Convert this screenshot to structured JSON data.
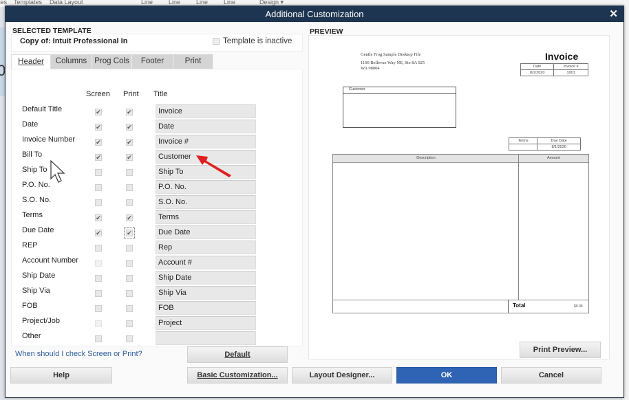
{
  "background": {
    "menu_items": [
      "tes",
      "Templates",
      "Data Layout",
      "Line",
      "Line",
      "Line",
      "Line",
      "Design ▾"
    ],
    "left_glyph": "0"
  },
  "dialog": {
    "title": "Additional Customization",
    "close_icon": "close-x-icon",
    "selected_template_label": "SELECTED TEMPLATE",
    "template_name": "Copy of: Intuit Professional In",
    "template_inactive_label": "Template is inactive",
    "template_inactive_checked": false,
    "tabs": [
      {
        "label": "Header",
        "active": true
      },
      {
        "label": "Columns",
        "active": false
      },
      {
        "label": "Prog Cols",
        "active": false
      },
      {
        "label": "Footer",
        "active": false
      },
      {
        "label": "Print",
        "active": false
      }
    ],
    "columns": {
      "screen": "Screen",
      "print": "Print",
      "title": "Title"
    },
    "rows": [
      {
        "label": "Default Title",
        "screen": true,
        "print": true,
        "title": "Invoice"
      },
      {
        "label": "Date",
        "screen": true,
        "print": true,
        "title": "Date"
      },
      {
        "label": "Invoice Number",
        "screen": true,
        "print": true,
        "title": "Invoice #"
      },
      {
        "label": "Bill To",
        "screen": true,
        "print": true,
        "title": "Customer"
      },
      {
        "label": "Ship To",
        "screen": false,
        "print": false,
        "title": "Ship To"
      },
      {
        "label": "P.O. No.",
        "screen": false,
        "print": false,
        "title": "P.O. No."
      },
      {
        "label": "S.O. No.",
        "screen": false,
        "print": false,
        "title": "S.O. No."
      },
      {
        "label": "Terms",
        "screen": true,
        "print": true,
        "title": "Terms"
      },
      {
        "label": "Due Date",
        "screen": true,
        "print": true,
        "title": "Due Date"
      },
      {
        "label": "REP",
        "screen": false,
        "print": false,
        "title": "Rep"
      },
      {
        "label": "Account Number",
        "screen": false,
        "print": false,
        "title": "Account #"
      },
      {
        "label": "Ship Date",
        "screen": false,
        "print": false,
        "title": "Ship Date"
      },
      {
        "label": "Ship Via",
        "screen": false,
        "print": false,
        "title": "Ship Via"
      },
      {
        "label": "FOB",
        "screen": false,
        "print": false,
        "title": "FOB"
      },
      {
        "label": "Project/Job",
        "screen": false,
        "print": false,
        "title": "Project"
      },
      {
        "label": "Other",
        "screen": false,
        "print": false,
        "title": ""
      }
    ],
    "help_link": "When should I check Screen or Print?",
    "default_button": "Default",
    "preview_label": "PREVIEW",
    "print_preview_button": "Print Preview...",
    "buttons": {
      "help": "Help",
      "basic_customization": "Basic Customization...",
      "layout_designer": "Layout Designer...",
      "ok": "OK",
      "cancel": "Cancel"
    }
  },
  "preview": {
    "company_name": "Gentle Frog Sample Desktop File",
    "address_line1": "1100 Bellevue Way NE, Ste 8A 025",
    "address_line2": "WA 98004",
    "doc_title": "Invoice",
    "date_header": "Date",
    "invoice_no_header": "Invoice #",
    "date_value": "8/1/2020",
    "invoice_no_value": "1001",
    "bill_to_header": "Customer",
    "terms_header": "Terms",
    "due_date_header": "Due Date",
    "terms_value": "",
    "due_date_value": "8/1/2020",
    "description_header": "Description",
    "amount_header": "Amount",
    "total_label": "Total",
    "total_value": "$0.00"
  },
  "overlay": {
    "cursor": "mouse-pointer-icon",
    "arrow": "red-arrow-annotation",
    "arrow_color": "#e02020"
  }
}
